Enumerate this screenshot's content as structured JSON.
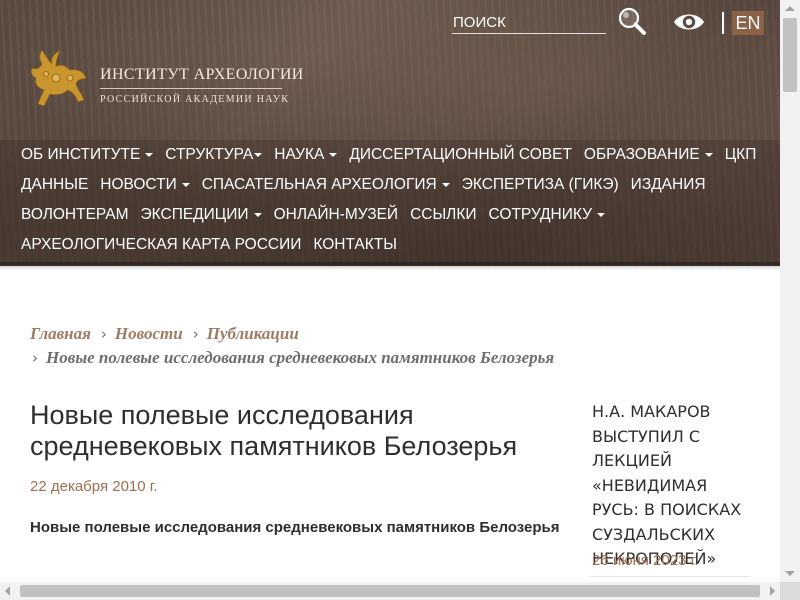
{
  "header": {
    "search": {
      "placeholder": "ПОИСК",
      "value": ""
    },
    "language_label": "EN",
    "logo": {
      "title": "ИНСТИТУТ АРХЕОЛОГИИ",
      "subtitle": "РОССИЙСКОЙ АКАДЕМИИ НАУК",
      "icon": "golden-deer-icon"
    },
    "icons": {
      "search": "magnifier-icon",
      "accessibility": "eye-icon"
    },
    "accent_color": "#8b6148"
  },
  "nav": {
    "rows": [
      [
        {
          "label": "ОБ ИНСТИТУТЕ",
          "dropdown": true
        },
        {
          "label": "СТРУКТУРА",
          "dropdown": true
        },
        {
          "label": "НАУКА",
          "dropdown": true
        },
        {
          "label": "ДИССЕРТАЦИОННЫЙ СОВЕТ",
          "dropdown": false
        },
        {
          "label": "ОБРАЗОВАНИЕ",
          "dropdown": true
        },
        {
          "label": "ЦКП",
          "dropdown": false
        }
      ],
      [
        {
          "label": "ДАННЫЕ",
          "dropdown": false
        },
        {
          "label": "НОВОСТИ",
          "dropdown": true
        },
        {
          "label": "СПАСАТЕЛЬНАЯ АРХЕОЛОГИЯ",
          "dropdown": true
        },
        {
          "label": "ЭКСПЕРТИЗА (ГИКЭ)",
          "dropdown": false
        },
        {
          "label": "ИЗДАНИЯ",
          "dropdown": false
        }
      ],
      [
        {
          "label": "ВОЛОНТЕРАМ",
          "dropdown": false
        },
        {
          "label": "ЭКСПЕДИЦИИ",
          "dropdown": true
        },
        {
          "label": "ОНЛАЙН-МУЗЕЙ",
          "dropdown": false
        },
        {
          "label": "ССЫЛКИ",
          "dropdown": false
        },
        {
          "label": "СОТРУДНИКУ",
          "dropdown": true
        }
      ],
      [
        {
          "label": "АРХЕОЛОГИЧЕСКАЯ КАРТА РОССИИ",
          "dropdown": false
        },
        {
          "label": "КОНТАКТЫ",
          "dropdown": false
        }
      ]
    ]
  },
  "breadcrumb": {
    "items": [
      "Главная",
      "Новости",
      "Публикации"
    ],
    "current": "Новые полевые исследования средневековых памятников Белозерья",
    "link_color": "#a07b63"
  },
  "article": {
    "title": "Новые полевые исследования средневековых памятников Белозерья",
    "date": "22 декабря 2010 г.",
    "lead": "Новые полевые исследования средневековых памятников Белозерья",
    "date_color": "#a06f4e"
  },
  "sidebar": {
    "news_title": "Н.А. МАКАРОВ\nВЫСТУПИЛ С\nЛЕКЦИЕЙ «НЕВИДИМАЯ\nРУСЬ: В ПОИСКАХ\nСУЗДАЛЬСКИХ\nНЕКРОПОЛЕЙ»",
    "news_date": "26 июня 2023 г."
  }
}
